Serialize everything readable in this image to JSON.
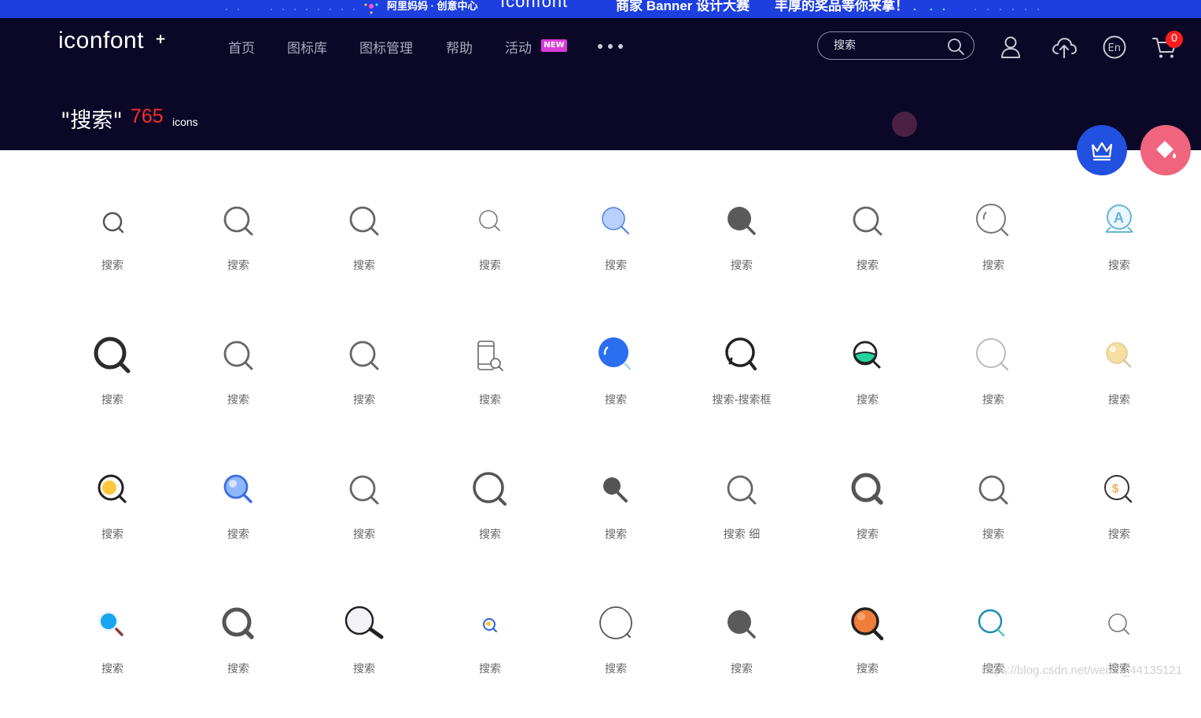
{
  "banner": {
    "text1": "阿里妈妈 · 创意中心",
    "text2": "Iconfont",
    "text3": "商家 Banner 设计大赛",
    "text4": "丰厚的奖品等你来拿！"
  },
  "header": {
    "logo": "iconfont",
    "nav": [
      "首页",
      "图标库",
      "图标管理",
      "帮助",
      "活动"
    ],
    "new_badge": "NEW",
    "search_placeholder": "搜索",
    "cart_count": "0"
  },
  "result": {
    "title": "\"搜索\"",
    "count": "765",
    "unit": "icons"
  },
  "icons": [
    {
      "label": "搜索",
      "icon": "search-outline-small"
    },
    {
      "label": "搜索",
      "icon": "search-outline"
    },
    {
      "label": "搜索",
      "icon": "search-outline"
    },
    {
      "label": "搜索",
      "icon": "search-thin-small"
    },
    {
      "label": "搜索",
      "icon": "search-light-blue"
    },
    {
      "label": "搜索",
      "icon": "search-filled-gray"
    },
    {
      "label": "搜索",
      "icon": "search-outline"
    },
    {
      "label": "搜索",
      "icon": "search-thin-large"
    },
    {
      "label": "搜索",
      "icon": "search-letter-a"
    },
    {
      "label": "搜索",
      "icon": "search-bold-black"
    },
    {
      "label": "搜索",
      "icon": "search-outline"
    },
    {
      "label": "搜索",
      "icon": "search-outline"
    },
    {
      "label": "搜索",
      "icon": "search-phone"
    },
    {
      "label": "搜索",
      "icon": "search-blue-filled"
    },
    {
      "label": "搜索-搜索框",
      "icon": "search-black-round"
    },
    {
      "label": "搜索",
      "icon": "search-green-half"
    },
    {
      "label": "搜索",
      "icon": "search-light-gray"
    },
    {
      "label": "搜索",
      "icon": "search-yellow-light"
    },
    {
      "label": "搜索",
      "icon": "search-yellow-dot"
    },
    {
      "label": "搜索",
      "icon": "search-blue-outline"
    },
    {
      "label": "搜索",
      "icon": "search-outline"
    },
    {
      "label": "搜索",
      "icon": "search-outline-bold"
    },
    {
      "label": "搜索",
      "icon": "search-filled-small"
    },
    {
      "label": "搜索 细",
      "icon": "search-outline"
    },
    {
      "label": "搜索",
      "icon": "search-bold-gray"
    },
    {
      "label": "搜索",
      "icon": "search-outline"
    },
    {
      "label": "搜索",
      "icon": "search-dollar"
    },
    {
      "label": "搜索",
      "icon": "search-cyan-filled"
    },
    {
      "label": "搜索",
      "icon": "search-bold-gray"
    },
    {
      "label": "搜索",
      "icon": "search-magnifier-large"
    },
    {
      "label": "搜索",
      "icon": "search-tiny-color"
    },
    {
      "label": "搜索",
      "icon": "search-circle-thin"
    },
    {
      "label": "搜索",
      "icon": "search-filled-gray"
    },
    {
      "label": "搜索",
      "icon": "search-orange-filled"
    },
    {
      "label": "搜索",
      "icon": "search-teal-outline"
    },
    {
      "label": "搜索",
      "icon": "search-thin-small"
    }
  ],
  "watermark": "https://blog.csdn.net/weixin_44135121"
}
